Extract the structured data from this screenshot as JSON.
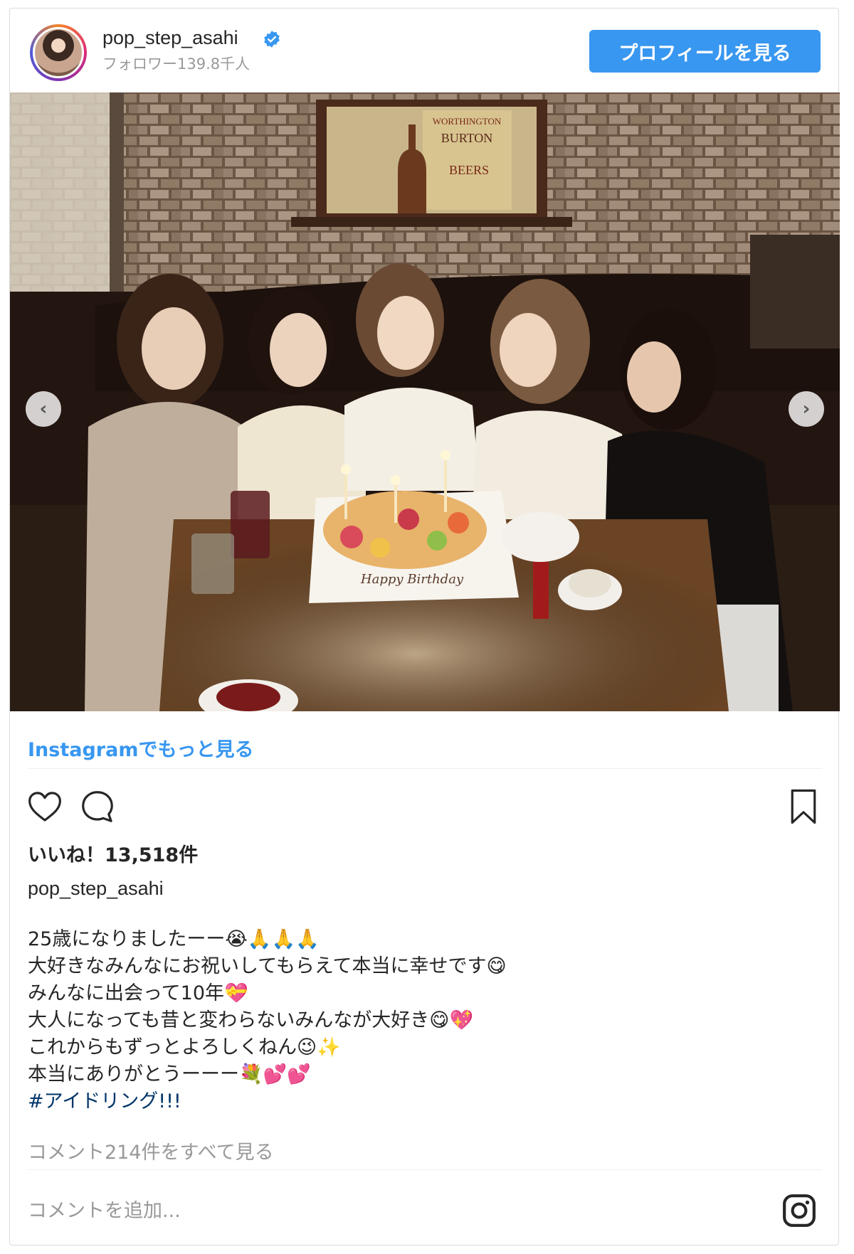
{
  "header": {
    "username": "pop_step_asahi",
    "followers": "フォロワー139.8千人",
    "profile_button": "プロフィールを見る"
  },
  "photo": {
    "sign_text_1": "WORTHINGTON",
    "sign_text_2": "BURTON",
    "sign_text_3": "BEERS",
    "plate_text": "Happy Birthday"
  },
  "more_link": "Instagramでもっと見る",
  "actions": {
    "like_icon": "heart-icon",
    "comment_icon": "comment-icon",
    "save_icon": "bookmark-icon"
  },
  "likes": "いいね！13,518件",
  "caption": {
    "username": "pop_step_asahi",
    "lines": [
      "25歳になりましたーー😭🙏🙏🙏",
      "大好きなみんなにお祝いしてもらえて本当に幸せです😋",
      "みんなに出会って10年💝",
      "大人になっても昔と変わらないみんなが大好き😋💖",
      "これからもずっとよろしくねん😉✨",
      "本当にありがとうーーー💐💕💕"
    ],
    "hashtag": "#アイドリング!!!"
  },
  "view_comments": "コメント214件をすべて見る",
  "comment_placeholder": "コメントを追加...",
  "colors": {
    "accent": "#3897f0",
    "hashtag": "#003569",
    "muted": "#999999"
  }
}
